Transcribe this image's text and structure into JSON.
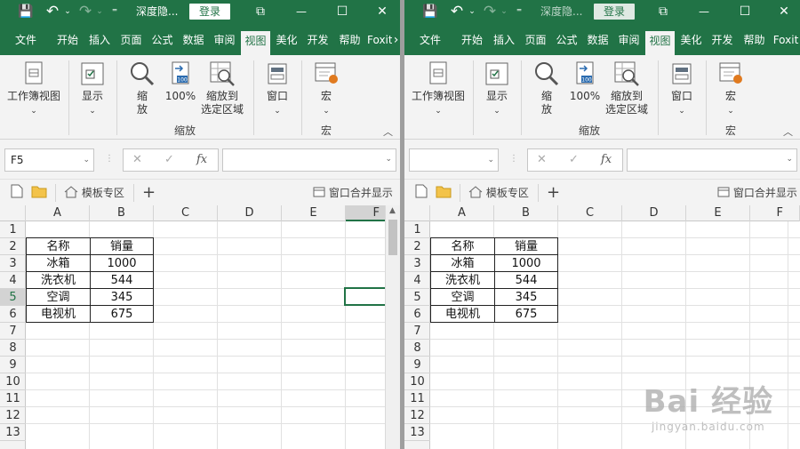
{
  "titlebar": {
    "title_left": "深度隐...",
    "title_right": "深度隐...",
    "login_label": "登录",
    "save_glyph": "💾",
    "undo_glyph": "↶",
    "redo_glyph": "↷",
    "customize_glyph": "⁼",
    "restore_glyph": "⧉",
    "minimize_glyph": "—",
    "maximize_glyph": "☐",
    "close_glyph": "✕"
  },
  "menu_tabs": [
    "文件",
    "开始",
    "插入",
    "页面",
    "公式",
    "数据",
    "审阅",
    "视图",
    "美化",
    "开发",
    "帮助",
    "Foxit"
  ],
  "menu_more": "›",
  "active_tab": "视图",
  "ribbon": {
    "workbook_view": "工作簿视图",
    "show": "显示",
    "zoom": "缩\n放",
    "zoom_line1": "缩",
    "zoom_line2": "放",
    "zoom_100": "100%",
    "zoom_to_selection_line1": "缩放到",
    "zoom_to_selection_line2": "选定区域",
    "window": "窗口",
    "macro": "宏",
    "group_zoom": "缩放",
    "group_macro": "宏",
    "dropdown": "⌄",
    "collapse": "︿"
  },
  "formula_bar": {
    "name_box_left": "F5",
    "name_box_right": "",
    "cancel_glyph": "✕",
    "enter_glyph": "✓",
    "fx_label": "fx",
    "formula_value": ""
  },
  "quick_bar": {
    "template_zone": "模板专区",
    "add": "+",
    "merge_windows": "窗口合并显示"
  },
  "columns": [
    "A",
    "B",
    "C",
    "D",
    "E",
    "F"
  ],
  "rows": [
    "1",
    "2",
    "3",
    "4",
    "5",
    "6",
    "7",
    "8",
    "9",
    "10",
    "11",
    "12",
    "13"
  ],
  "table": {
    "header": [
      "名称",
      "销量"
    ],
    "rows": [
      [
        "冰箱",
        "1000"
      ],
      [
        "洗衣机",
        "544"
      ],
      [
        "空调",
        "345"
      ],
      [
        "电视机",
        "675"
      ]
    ]
  },
  "watermark": {
    "brand": "Bai 经验",
    "url": "jingyan.baidu.com"
  },
  "colors": {
    "excel_green": "#217346",
    "ribbon_bg": "#f3f3f3"
  }
}
